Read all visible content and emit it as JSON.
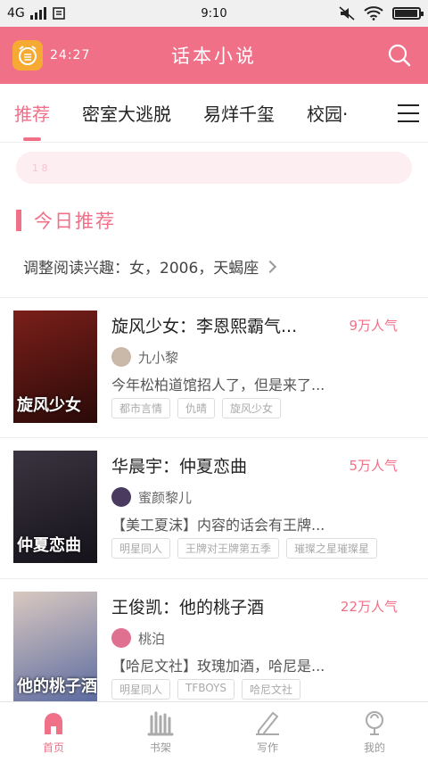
{
  "status_bar": {
    "network": "4G",
    "time": "9:10",
    "battery_level": 0.95
  },
  "header": {
    "alarm_time": "24:27",
    "title": "话本小说"
  },
  "tabs": [
    {
      "label": "推荐",
      "active": true
    },
    {
      "label": "密室大逃脱",
      "active": false
    },
    {
      "label": "易烊千玺",
      "active": false
    },
    {
      "label": "校园·",
      "active": false
    }
  ],
  "banner": {
    "text": "1 8"
  },
  "section": {
    "title": "今日推荐",
    "interest": "调整阅读兴趣：女，2006，天蝎座"
  },
  "books": [
    {
      "title": "旋风少女：李恩熙霸气...",
      "popularity": "9万人气",
      "author": "九小黎",
      "description": "今年松柏道馆招人了，但是来了...",
      "tags": [
        "都市言情",
        "仇晴",
        "旋风少女"
      ],
      "cover_text": "旋风少女",
      "cover_colors": [
        "#7a1f1a",
        "#2a0a08"
      ],
      "avatar_color": "#c9b8a8"
    },
    {
      "title": "华晨宇：仲夏恋曲",
      "popularity": "5万人气",
      "author": "蜜颜黎儿",
      "description": "【美工夏沫】内容的话会有王牌...",
      "tags": [
        "明星同人",
        "王牌对王牌第五季",
        "璀璨之星璀璨星"
      ],
      "cover_text": "仲夏恋曲",
      "cover_colors": [
        "#3a3440",
        "#15121a"
      ],
      "avatar_color": "#4a3a60"
    },
    {
      "title": "王俊凯：他的桃子酒",
      "popularity": "22万人气",
      "author": "桃泊",
      "description": "【哈尼文社】玫瑰加酒，哈尼是...",
      "tags": [
        "明星同人",
        "TFBOYS",
        "哈尼文社"
      ],
      "cover_text": "他的桃子酒",
      "cover_colors": [
        "#d9c8c0",
        "#5a6aa0"
      ],
      "avatar_color": "#e07090"
    }
  ],
  "bottom_nav": [
    {
      "label": "首页",
      "icon": "home-icon",
      "active": true
    },
    {
      "label": "书架",
      "icon": "bookshelf-icon",
      "active": false
    },
    {
      "label": "写作",
      "icon": "pen-icon",
      "active": false
    },
    {
      "label": "我的",
      "icon": "profile-icon",
      "active": false
    }
  ],
  "colors": {
    "accent": "#f07088",
    "alarm": "#f6a933"
  }
}
